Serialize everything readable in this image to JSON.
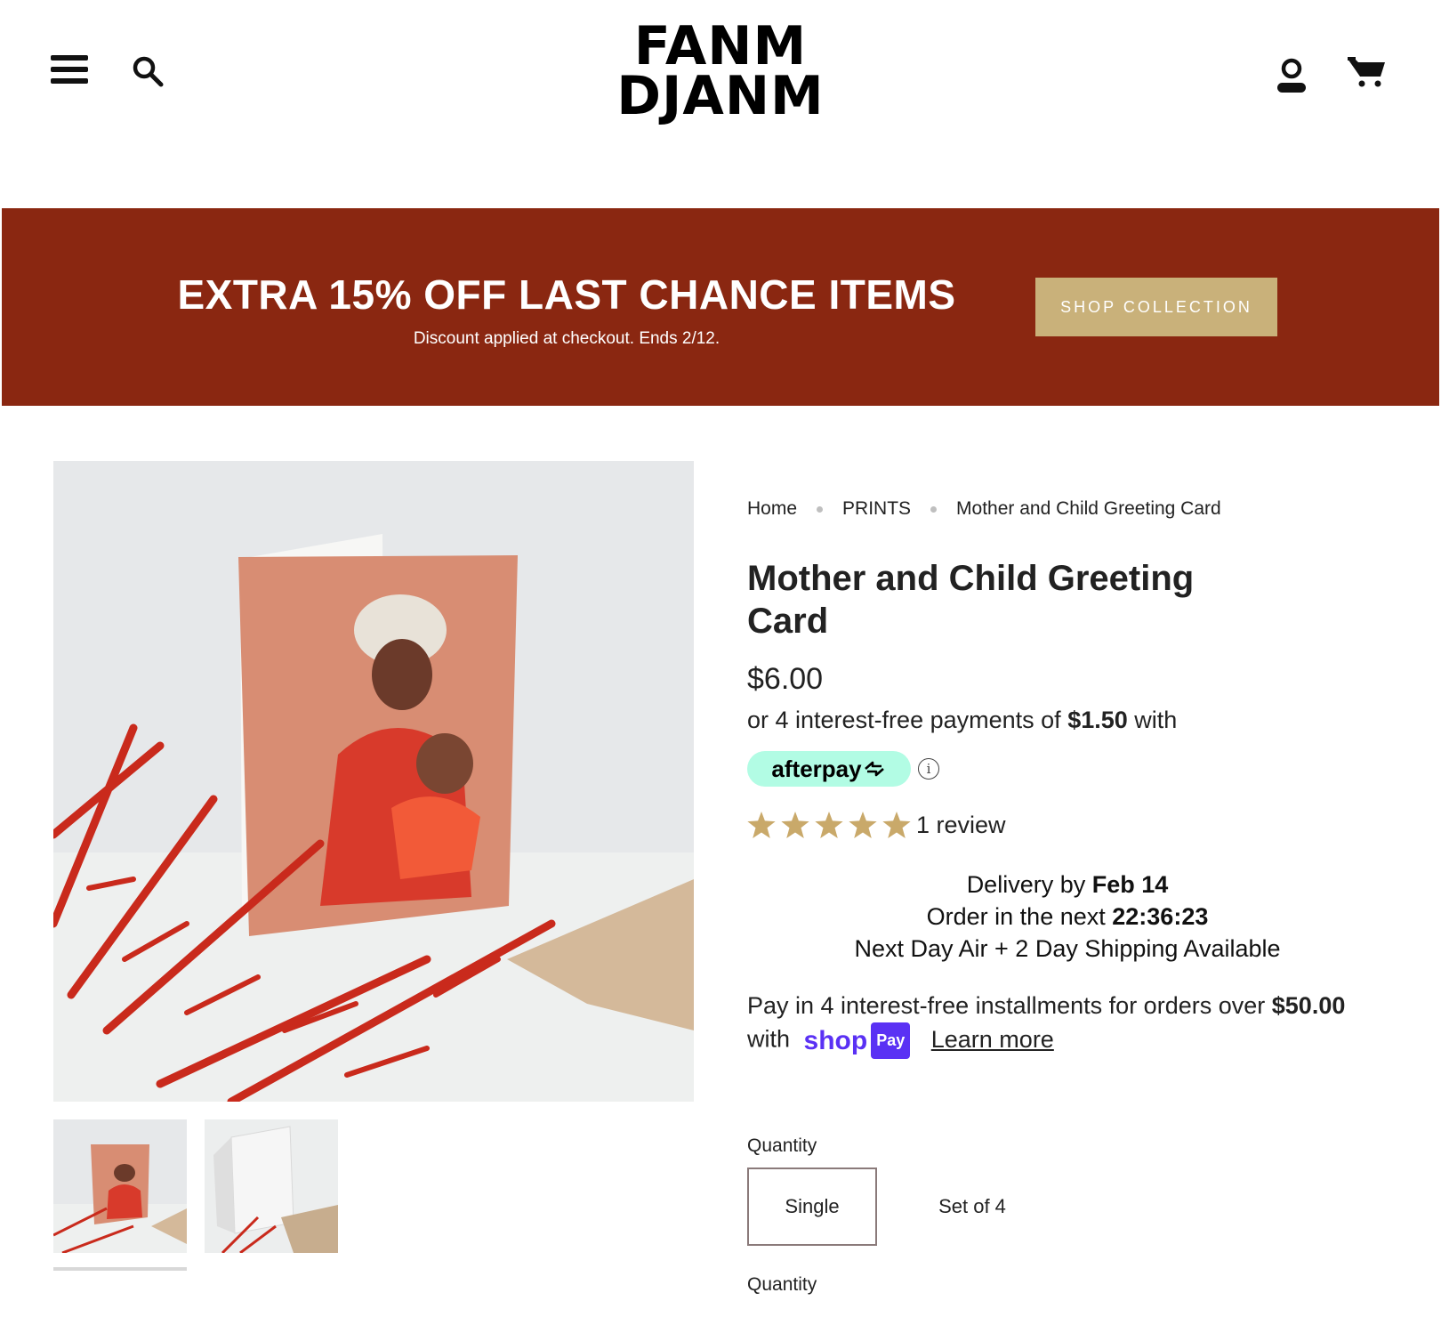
{
  "header": {
    "logo_line1": "FANM",
    "logo_line2": "DJANM"
  },
  "banner": {
    "title": "EXTRA 15% OFF LAST CHANCE ITEMS",
    "subtitle": "Discount applied at checkout. Ends 2/12.",
    "button_label": "SHOP COLLECTION",
    "background_color": "#8a2711",
    "button_color": "#c9b17a"
  },
  "breadcrumb": {
    "items": [
      "Home",
      "PRINTS",
      "Mother and Child Greeting Card"
    ]
  },
  "product": {
    "title": "Mother and Child Greeting Card",
    "price": "$6.00",
    "installment_prefix": "or 4 interest-free payments of",
    "installment_amount": "$1.50",
    "installment_suffix": "with",
    "afterpay_label": "afterpay",
    "rating_stars": 5,
    "review_count": "1 review",
    "star_color": "#c9a96a"
  },
  "delivery": {
    "line1_prefix": "Delivery by",
    "line1_date": "Feb 14",
    "line2_prefix": "Order in the next",
    "line2_timer": "22:36:23",
    "line3": "Next Day Air + 2 Day Shipping Available"
  },
  "shop_pay": {
    "text_prefix": "Pay in 4 interest-free installments for orders over",
    "threshold": "$50.00",
    "with": "with",
    "shop_word": "shop",
    "pay_word": "Pay",
    "learn_more": "Learn more",
    "brand_color": "#5a31f4"
  },
  "quantity": {
    "label": "Quantity",
    "options": [
      "Single",
      "Set of 4"
    ],
    "selected": "Single",
    "label2": "Quantity"
  }
}
